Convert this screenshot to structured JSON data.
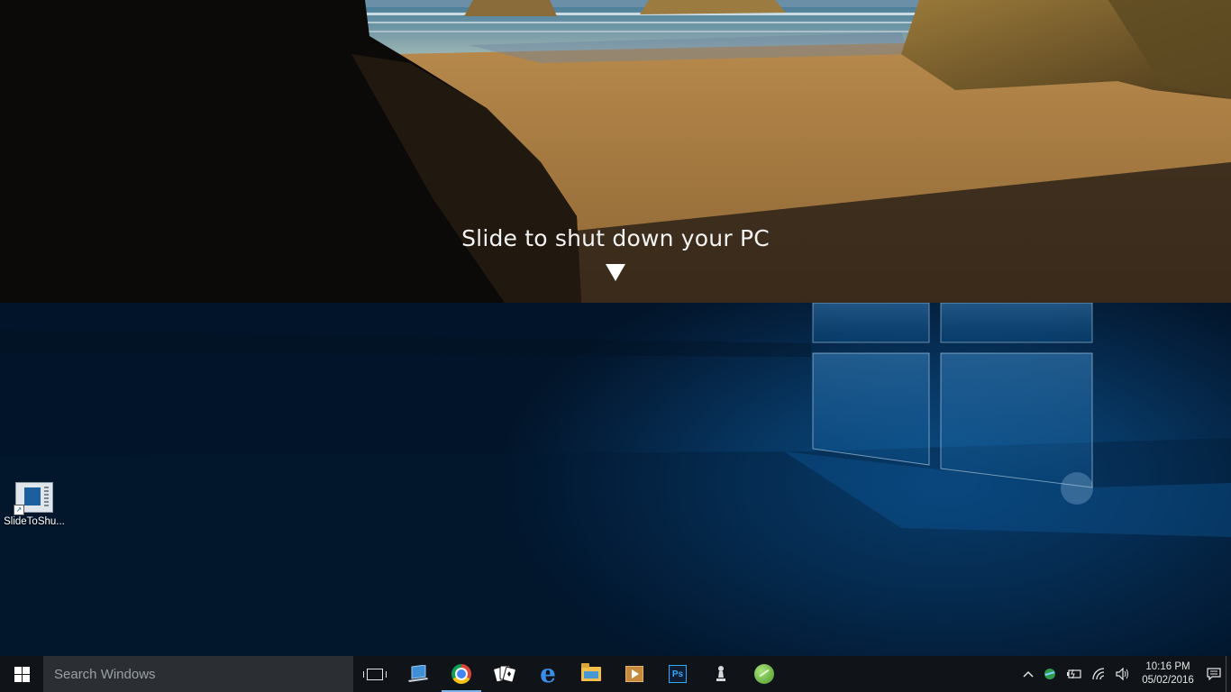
{
  "slide": {
    "caption": "Slide to shut down your PC",
    "arrow_icon": "arrow-down-triangle-icon"
  },
  "desktop": {
    "icons": [
      {
        "label": "SlideToShu...",
        "icon": "slide-to-shutdown-app-icon"
      }
    ]
  },
  "taskbar": {
    "start_icon": "windows-logo-icon",
    "search_placeholder": "Search Windows",
    "ps_label": "Ps",
    "apps": [
      {
        "name": "task-view",
        "icon": "task-view-icon"
      },
      {
        "name": "laptop-app",
        "icon": "laptop-icon"
      },
      {
        "name": "chrome",
        "icon": "chrome-icon",
        "active": true
      },
      {
        "name": "solitaire",
        "icon": "cards-icon"
      },
      {
        "name": "edge",
        "icon": "edge-icon"
      },
      {
        "name": "file-explorer",
        "icon": "folder-icon"
      },
      {
        "name": "media-player",
        "icon": "video-icon"
      },
      {
        "name": "photoshop",
        "icon": "photoshop-icon"
      },
      {
        "name": "chess",
        "icon": "chess-pawn-icon"
      },
      {
        "name": "spring-app",
        "icon": "leaf-icon"
      }
    ],
    "tray": {
      "icons": [
        "chevron-up-icon",
        "network-globe-icon",
        "battery-icon",
        "wifi-icon",
        "volume-icon",
        "notifications-icon"
      ],
      "time": "10:16 PM",
      "date": "05/02/2016"
    }
  },
  "colors": {
    "taskbar_bg": "#101418",
    "search_bg": "#2b2f33",
    "accent": "#7ab4e8",
    "desktop_blue": "#073661"
  }
}
